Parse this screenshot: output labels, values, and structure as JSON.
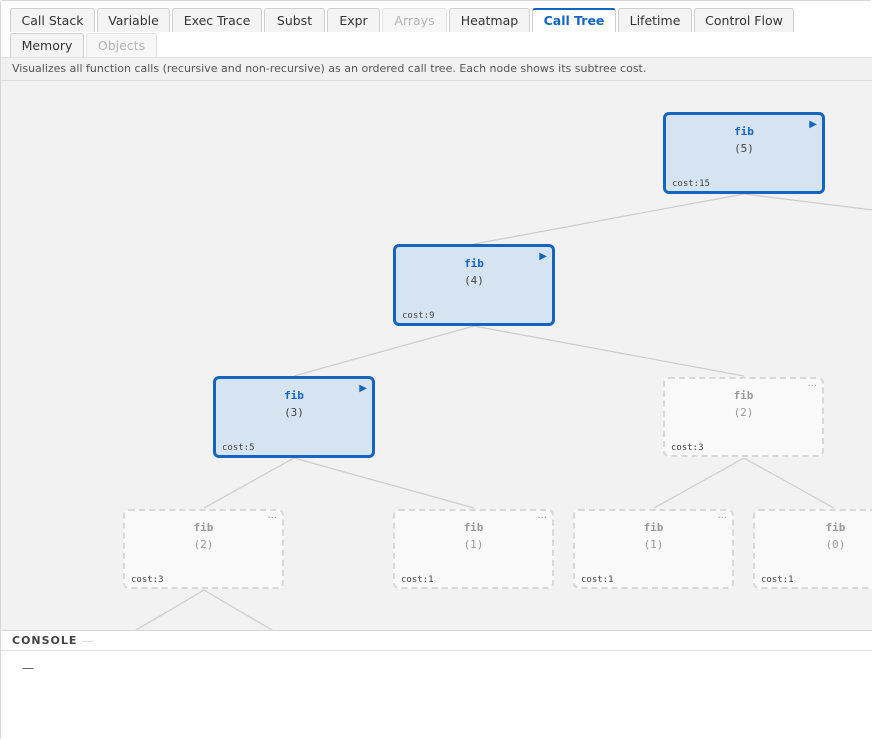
{
  "tabs": [
    {
      "label": "Call Stack",
      "state": "normal"
    },
    {
      "label": "Variable",
      "state": "normal"
    },
    {
      "label": "Exec Trace",
      "state": "normal"
    },
    {
      "label": "Subst",
      "state": "normal"
    },
    {
      "label": "Expr",
      "state": "normal"
    },
    {
      "label": "Arrays",
      "state": "disabled"
    },
    {
      "label": "Heatmap",
      "state": "normal"
    },
    {
      "label": "Call Tree",
      "state": "active"
    },
    {
      "label": "Lifetime",
      "state": "normal"
    },
    {
      "label": "Control Flow",
      "state": "normal"
    },
    {
      "label": "Memory",
      "state": "normal"
    },
    {
      "label": "Objects",
      "state": "disabled"
    }
  ],
  "description": "Visualizes all function calls (recursive and non-recursive) as an ordered call tree. Each node shows its subtree cost.",
  "call_tree": {
    "nodes": [
      {
        "fn": "fib",
        "args": "(5)",
        "cost": "cost:15",
        "state": "active",
        "marker": "▶"
      },
      {
        "fn": "fib",
        "args": "(4)",
        "cost": "cost:9",
        "state": "active",
        "marker": "▶"
      },
      {
        "fn": "fib",
        "args": "(3)",
        "cost": "cost:5",
        "state": "active",
        "marker": "▶"
      },
      {
        "fn": "fib",
        "args": "(2)",
        "cost": "cost:3",
        "state": "pending",
        "marker": "···"
      },
      {
        "fn": "fib",
        "args": "(2)",
        "cost": "cost:3",
        "state": "pending",
        "marker": "···"
      },
      {
        "fn": "fib",
        "args": "(1)",
        "cost": "cost:1",
        "state": "pending",
        "marker": "···"
      },
      {
        "fn": "fib",
        "args": "(1)",
        "cost": "cost:1",
        "state": "pending",
        "marker": "···"
      },
      {
        "fn": "fib",
        "args": "(0)",
        "cost": "cost:1",
        "state": "pending",
        "marker": ""
      }
    ]
  },
  "console": {
    "title": "CONSOLE",
    "output": "—"
  },
  "colors": {
    "accent": "#1565c0",
    "active_node_fill": "#d6e3f0",
    "canvas_bg": "#f2f2f2",
    "edge": "#cccccc"
  }
}
